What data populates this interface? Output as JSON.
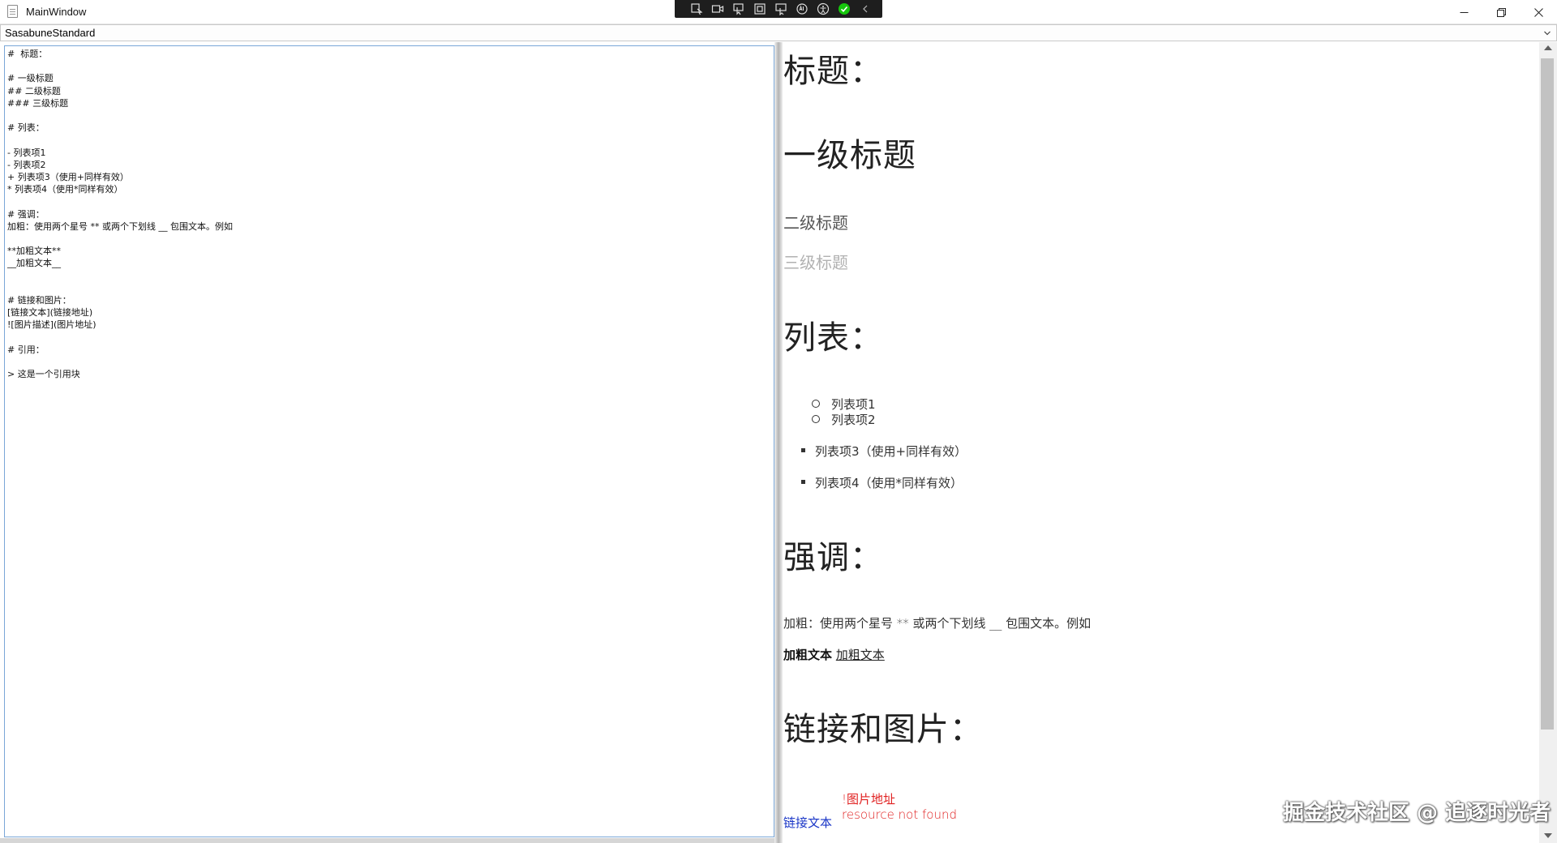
{
  "window": {
    "title": "MainWindow"
  },
  "dev_toolbar": {
    "tools": [
      "select-element-icon",
      "video-icon",
      "pointer-icon",
      "frame-icon",
      "hover-icon",
      "ab-icon",
      "accessibility-icon",
      "check-icon",
      "collapse-icon"
    ],
    "accent": "#16c60c"
  },
  "theme_select": {
    "value": "SasabuneStandard"
  },
  "editor": {
    "lines": [
      "#  标题：",
      "",
      "# 一级标题",
      "## 二级标题",
      "### 三级标题",
      "",
      "# 列表：",
      "",
      "- 列表项1",
      "- 列表项2",
      "+ 列表项3（使用+同样有效）",
      "* 列表项4（使用*同样有效）",
      "",
      "# 强调：",
      "加粗：使用两个星号 ** 或两个下划线 __ 包围文本。例如",
      "",
      "**加粗文本**",
      "__加粗文本__",
      "",
      "",
      "# 链接和图片：",
      "[链接文本](链接地址)",
      "![图片描述](图片地址)",
      "",
      "# 引用：",
      "",
      "> 这是一个引用块"
    ]
  },
  "preview": {
    "h_title": "标题：",
    "h1": "一级标题",
    "h2": "二级标题",
    "h3": "三级标题",
    "h_list": "列表：",
    "list_dash": [
      "列表项1",
      "列表项2"
    ],
    "list_plus": "列表项3（使用+同样有效）",
    "list_star": "列表项4（使用*同样有效）",
    "h_emphasis": "强调：",
    "emphasis_text": "加粗：使用两个星号 ** 或两个下划线 __ 包围文本。例如",
    "bold_text": "加粗文本",
    "underline_text": "加粗文本",
    "h_links": "链接和图片：",
    "link_text": "链接文本",
    "image_alt": "!图片地址",
    "image_error": "resource not found"
  },
  "watermark": "掘金技术社区 @ 追逐时光者",
  "colors": {
    "link": "#1a36c7",
    "error": "#e02020",
    "editor_border": "#7aa7d8"
  }
}
